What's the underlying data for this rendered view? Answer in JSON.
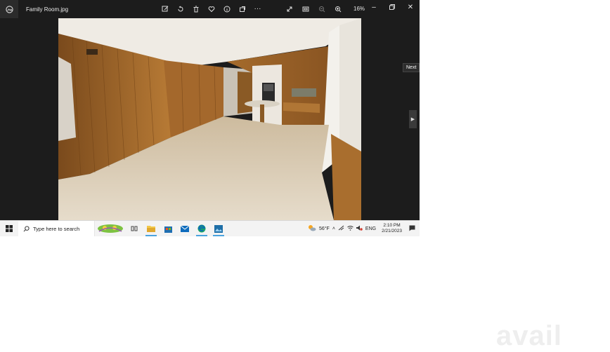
{
  "window": {
    "title": "Family Room.jpg"
  },
  "toolbar": {
    "buttons": [
      "edit-icon",
      "rotate-icon",
      "delete-icon",
      "favorite-icon",
      "info-icon",
      "add-to-album-icon",
      "more-icon"
    ],
    "more_label": "···",
    "zoom": "16%"
  },
  "viewer": {
    "next_tooltip": "Next"
  },
  "taskbar": {
    "search_placeholder": "Type here to search",
    "weather": "56°F",
    "language": "ENG",
    "time": "2:10 PM",
    "date": "2/21/2023"
  },
  "watermark": {
    "text": "avail"
  },
  "colors": {
    "accent": "#4aa3df",
    "viewer_bg": "#1c1c1c",
    "taskbar_bg": "#f3f3f3"
  }
}
